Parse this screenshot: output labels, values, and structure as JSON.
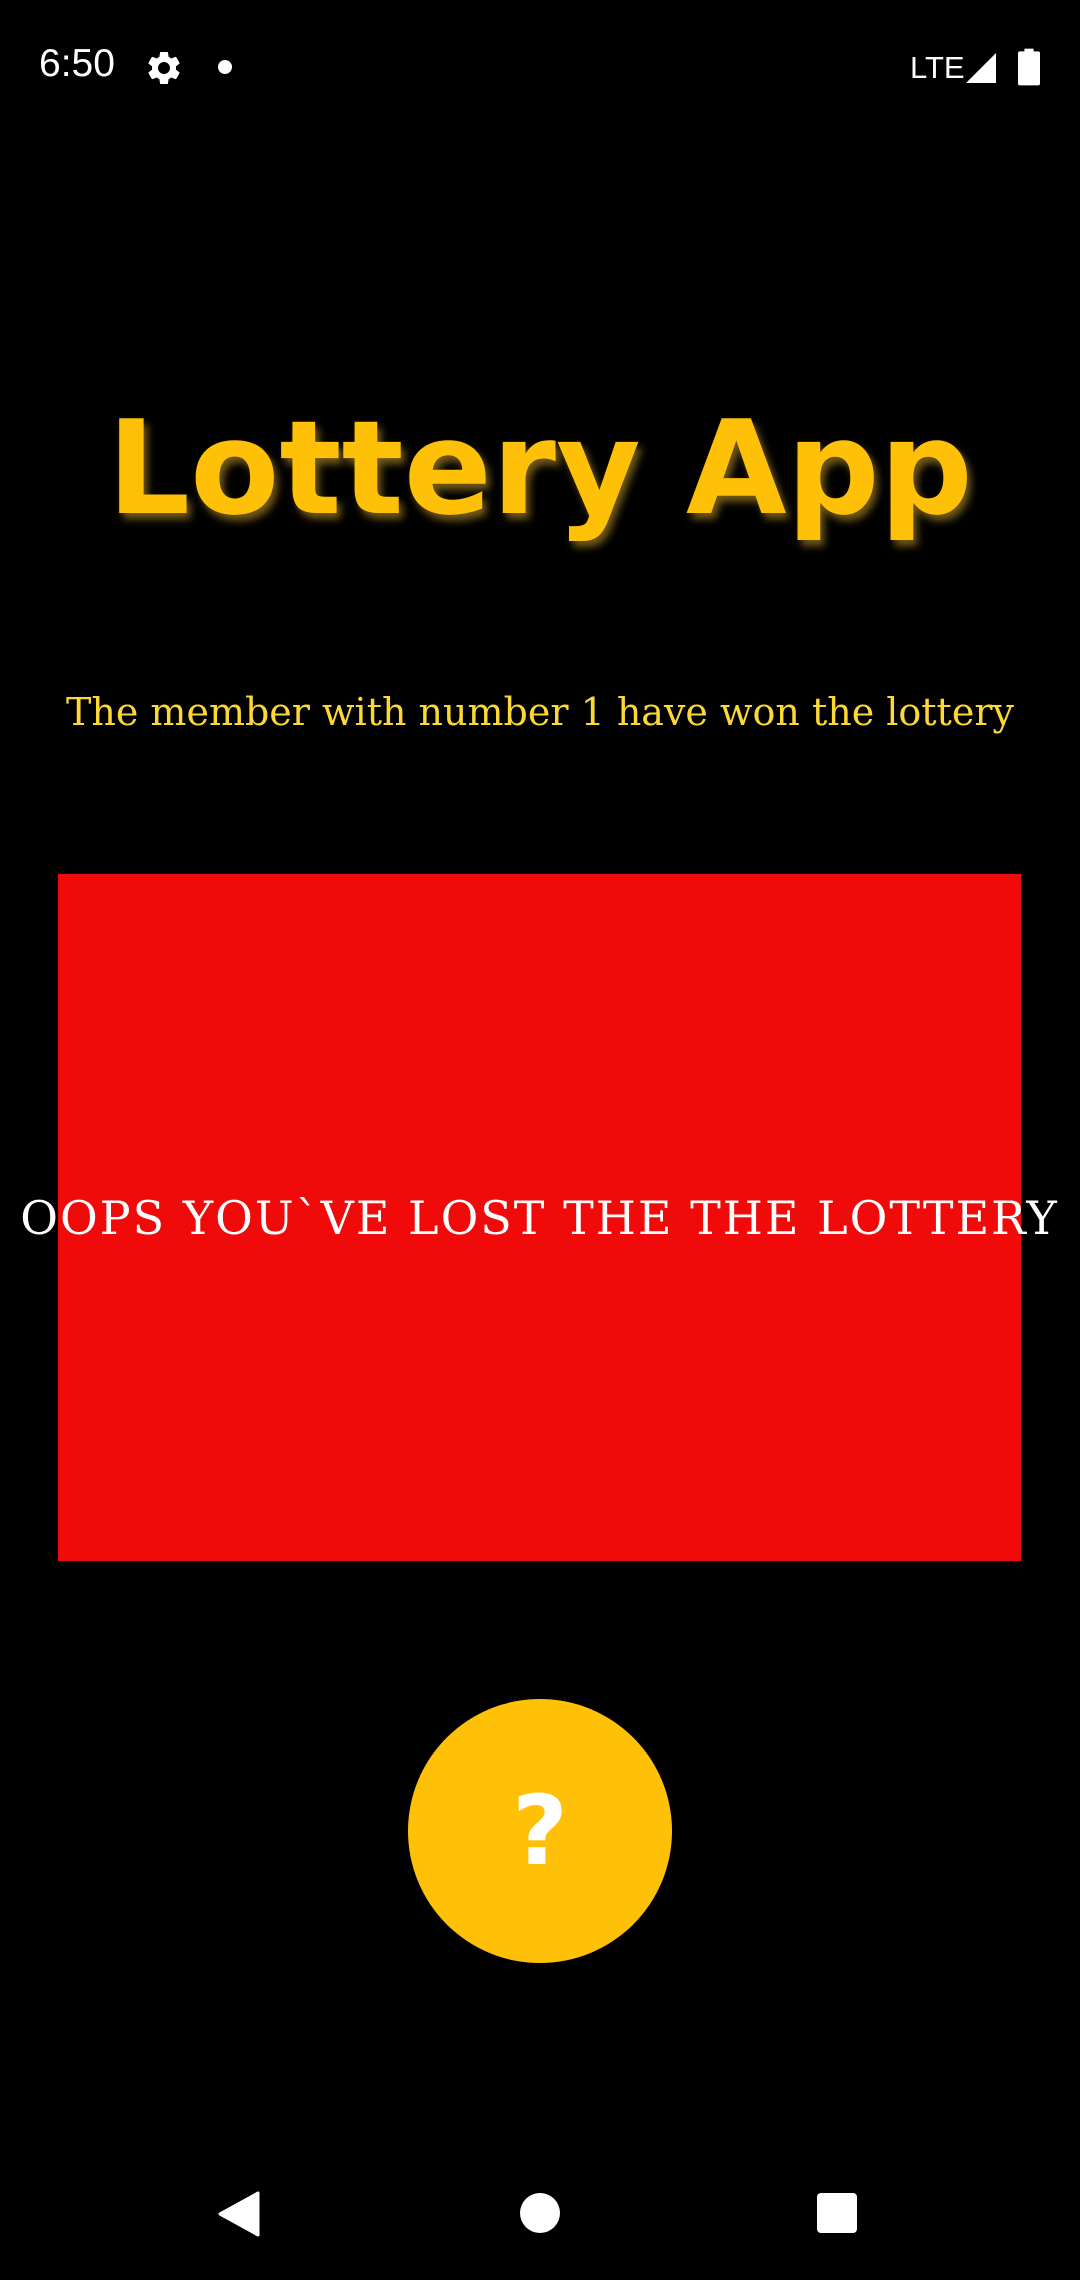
{
  "status_bar": {
    "time": "6:50",
    "network": "LTE",
    "icons": [
      "gear-icon",
      "dot-icon",
      "signal-icon",
      "battery-icon"
    ]
  },
  "app": {
    "title": "Lottery App",
    "winner_message": "The member with number 1 have won the lottery",
    "result_message": "OOPS YOU`VE LOST THE THE LOTTERY",
    "reveal_button_label": "?"
  },
  "nav_bar": {
    "icons": [
      "back-icon",
      "home-icon",
      "recents-icon"
    ]
  },
  "colors": {
    "background": "#000000",
    "accent": "#ffc107",
    "winner_text": "#fdd835",
    "result_panel": "#f00a0a",
    "text_on_dark": "#ffffff"
  }
}
